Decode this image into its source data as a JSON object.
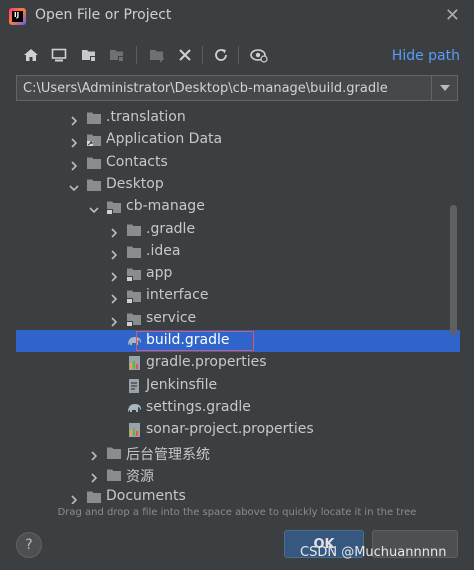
{
  "window": {
    "title": "Open File or Project",
    "logo_text": "IJ"
  },
  "toolbar": {
    "buttons": [
      "home-icon",
      "desktop-icon",
      "project-folder-icon",
      "module-folder-icon",
      "new-folder-icon",
      "delete-icon",
      "refresh-icon",
      "show-hidden-icon"
    ],
    "hide_path_label": "Hide path"
  },
  "path": {
    "value": "C:\\Users\\Administrator\\Desktop\\cb-manage\\build.gradle"
  },
  "tree": {
    "items": [
      {
        "label": ".translation",
        "depth": 3,
        "expand": "collapsed",
        "icon": "folder-icon"
      },
      {
        "label": "Application Data",
        "depth": 3,
        "expand": "collapsed",
        "icon": "shortcut-folder-icon"
      },
      {
        "label": "Contacts",
        "depth": 3,
        "expand": "collapsed",
        "icon": "folder-icon"
      },
      {
        "label": "Desktop",
        "depth": 3,
        "expand": "expanded",
        "icon": "folder-icon"
      },
      {
        "label": "cb-manage",
        "depth": 4,
        "expand": "expanded",
        "icon": "module-folder-icon"
      },
      {
        "label": ".gradle",
        "depth": 5,
        "expand": "collapsed",
        "icon": "folder-icon"
      },
      {
        "label": ".idea",
        "depth": 5,
        "expand": "collapsed",
        "icon": "folder-icon"
      },
      {
        "label": "app",
        "depth": 5,
        "expand": "collapsed",
        "icon": "module-folder-icon"
      },
      {
        "label": "interface",
        "depth": 5,
        "expand": "collapsed",
        "icon": "module-folder-icon"
      },
      {
        "label": "service",
        "depth": 5,
        "expand": "collapsed",
        "icon": "module-folder-icon"
      },
      {
        "label": "build.gradle",
        "depth": 5,
        "expand": "none",
        "icon": "gradle-elephant-icon",
        "selected": true
      },
      {
        "label": "gradle.properties",
        "depth": 5,
        "expand": "none",
        "icon": "properties-file-icon"
      },
      {
        "label": "Jenkinsfile",
        "depth": 5,
        "expand": "none",
        "icon": "text-file-icon"
      },
      {
        "label": "settings.gradle",
        "depth": 5,
        "expand": "none",
        "icon": "gradle-elephant-icon"
      },
      {
        "label": "sonar-project.properties",
        "depth": 5,
        "expand": "none",
        "icon": "properties-file-icon"
      },
      {
        "label": "后台管理系统",
        "depth": 4,
        "expand": "collapsed",
        "icon": "folder-icon"
      },
      {
        "label": "资源",
        "depth": 4,
        "expand": "collapsed",
        "icon": "folder-icon"
      },
      {
        "label": "Documents",
        "depth": 3,
        "expand": "collapsed",
        "icon": "folder-icon"
      }
    ]
  },
  "hint": "Drag and drop a file into the space above to quickly locate it in the tree",
  "buttons": {
    "help": "?",
    "ok": "OK"
  },
  "watermark": "CSDN @Muchuannnnn",
  "colors": {
    "background": "#3c3f41",
    "selection": "#2f65ca",
    "link": "#589df6",
    "folder": "#8a8d90",
    "highlight_border": "#e0575b"
  }
}
